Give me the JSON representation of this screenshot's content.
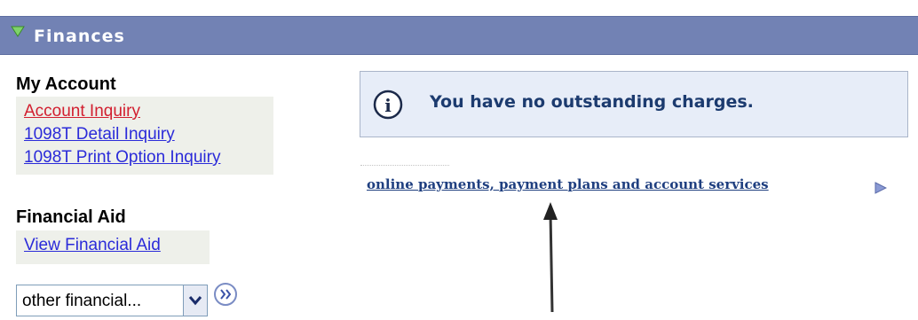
{
  "header": {
    "title": "Finances"
  },
  "my_account": {
    "title": "My Account",
    "links": [
      "Account Inquiry",
      "1098T Detail Inquiry",
      "1098T Print Option Inquiry"
    ]
  },
  "financial_aid": {
    "title": "Financial Aid",
    "links": [
      "View Financial Aid"
    ]
  },
  "other_select": {
    "value": "other financial..."
  },
  "message": {
    "text": "You have no outstanding charges."
  },
  "services_link": {
    "label": "online payments, payment plans and account services"
  },
  "colors": {
    "header_bg": "#7282b4",
    "link": "#2b2bd9",
    "active_link": "#d21f2f",
    "message_bg": "#e7edf8",
    "message_text": "#1c3b6f"
  }
}
